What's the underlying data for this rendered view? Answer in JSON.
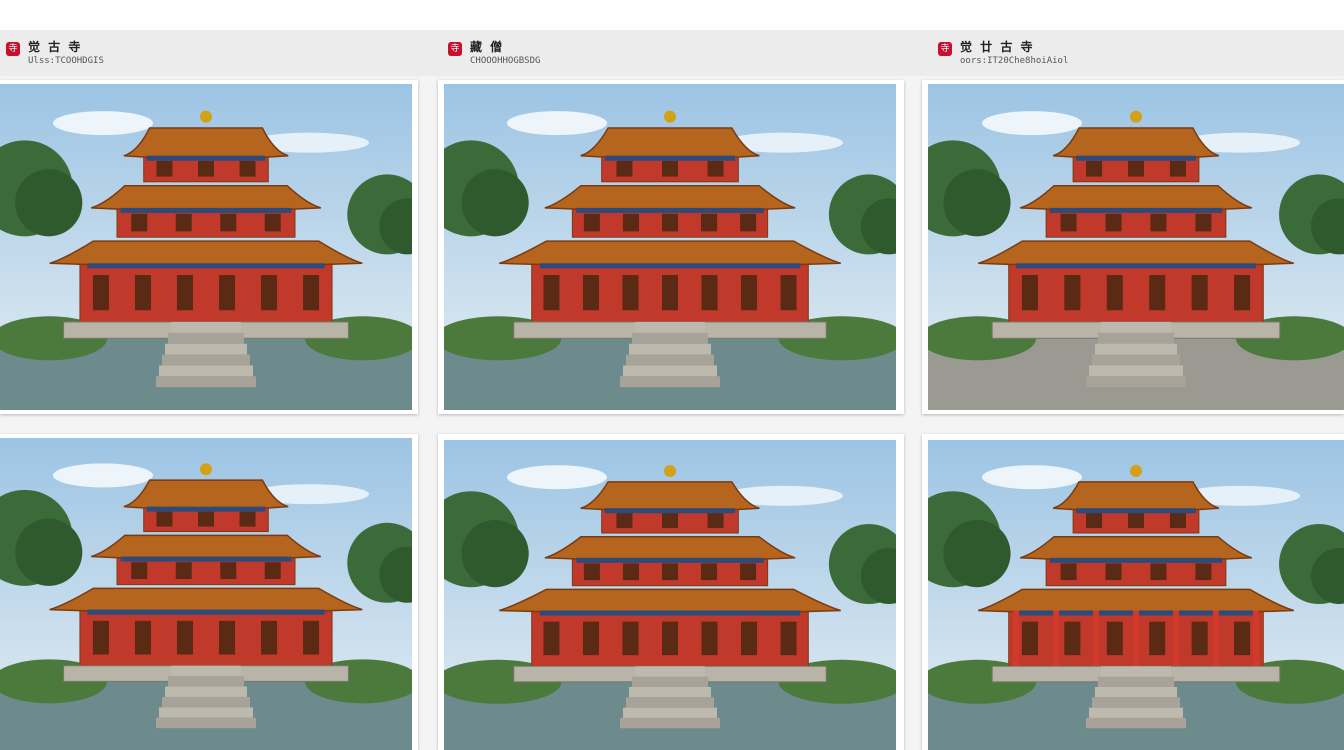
{
  "captions": [
    {
      "logo": "寺",
      "title": "觉 古 寺",
      "subtitle": "Ulss:TCOOHDGIS"
    },
    {
      "logo": "寺",
      "title": "藏 僧",
      "subtitle": "CHOOOHHOGBSDG"
    },
    {
      "logo": "寺",
      "title": "觉 廿 古 寺",
      "subtitle": "oors:IT20Che8hoiAiol"
    }
  ],
  "cards": [
    {
      "name": "temple-image-1",
      "variant": "garden"
    },
    {
      "name": "temple-image-2",
      "variant": "classic"
    },
    {
      "name": "temple-image-3",
      "variant": "plaza"
    },
    {
      "name": "temple-image-4",
      "variant": "lake"
    },
    {
      "name": "temple-image-5",
      "variant": "lake"
    },
    {
      "name": "temple-image-6",
      "variant": "pillars"
    }
  ],
  "colors": {
    "roof": "#b5651d",
    "roof_dark": "#7a3b12",
    "wall": "#c0392b",
    "beam": "#2c4a7a",
    "gold": "#d4a017",
    "sky_top": "#9cc4e4",
    "sky_bottom": "#e6eef3",
    "tree": "#3c6b3a",
    "water": "#6d8a8c",
    "stone": "#9a9a92"
  }
}
